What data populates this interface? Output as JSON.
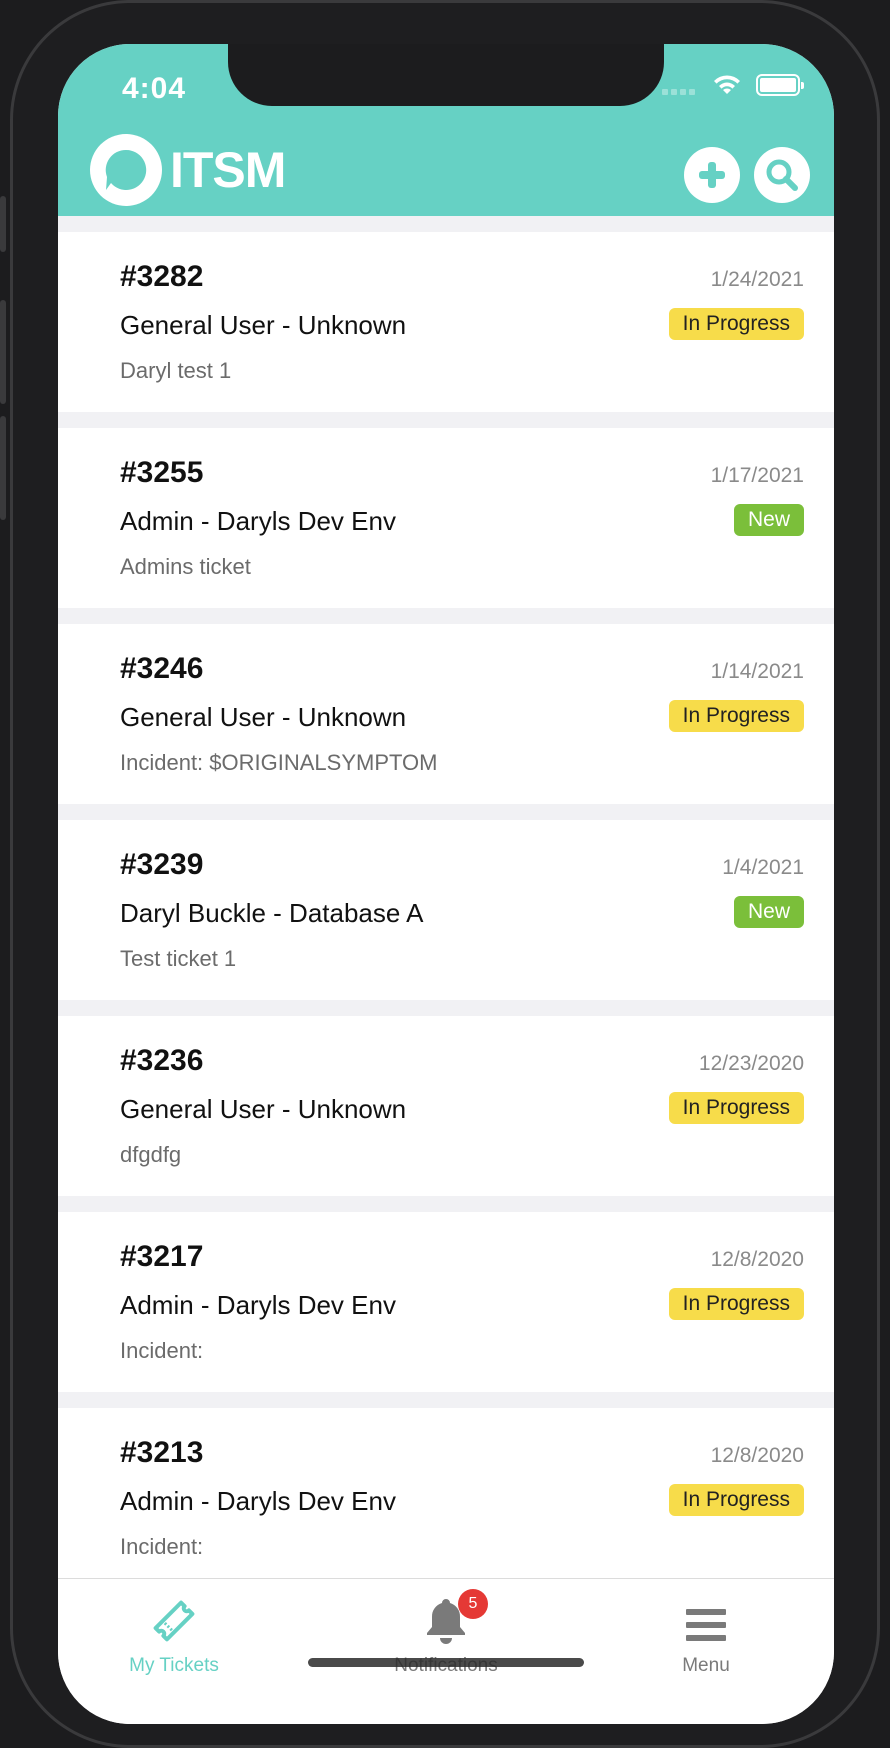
{
  "status_bar": {
    "time": "4:04"
  },
  "header": {
    "logo_text": "ITSM",
    "add_icon": "plus-circle-icon",
    "search_icon": "search-icon"
  },
  "tickets": [
    {
      "id": "#3282",
      "title": "General User - Unknown",
      "description": "Daryl test 1",
      "date": "1/24/2021",
      "status": "In Progress"
    },
    {
      "id": "#3255",
      "title": "Admin - Daryls Dev Env",
      "description": "Admins ticket",
      "date": "1/17/2021",
      "status": "New"
    },
    {
      "id": "#3246",
      "title": "General User - Unknown",
      "description": "Incident: $ORIGINALSYMPTOM",
      "date": "1/14/2021",
      "status": "In Progress"
    },
    {
      "id": "#3239",
      "title": "Daryl Buckle - Database A",
      "description": "Test ticket 1",
      "date": "1/4/2021",
      "status": "New"
    },
    {
      "id": "#3236",
      "title": "General User - Unknown",
      "description": "dfgdfg",
      "date": "12/23/2020",
      "status": "In Progress"
    },
    {
      "id": "#3217",
      "title": "Admin - Daryls Dev Env",
      "description": "Incident:",
      "date": "12/8/2020",
      "status": "In Progress"
    },
    {
      "id": "#3213",
      "title": "Admin - Daryls Dev Env",
      "description": "Incident:",
      "date": "12/8/2020",
      "status": "In Progress"
    }
  ],
  "tabbar": {
    "tabs": [
      {
        "label": "My Tickets",
        "icon": "ticket-icon"
      },
      {
        "label": "Notifications",
        "icon": "bell-icon",
        "badge": "5"
      },
      {
        "label": "Menu",
        "icon": "hamburger-menu-icon"
      }
    ]
  },
  "colors": {
    "brand": "#66d1c4",
    "in_progress": "#f7dc4a",
    "new": "#7bbf3a",
    "notification_badge": "#e53935"
  }
}
